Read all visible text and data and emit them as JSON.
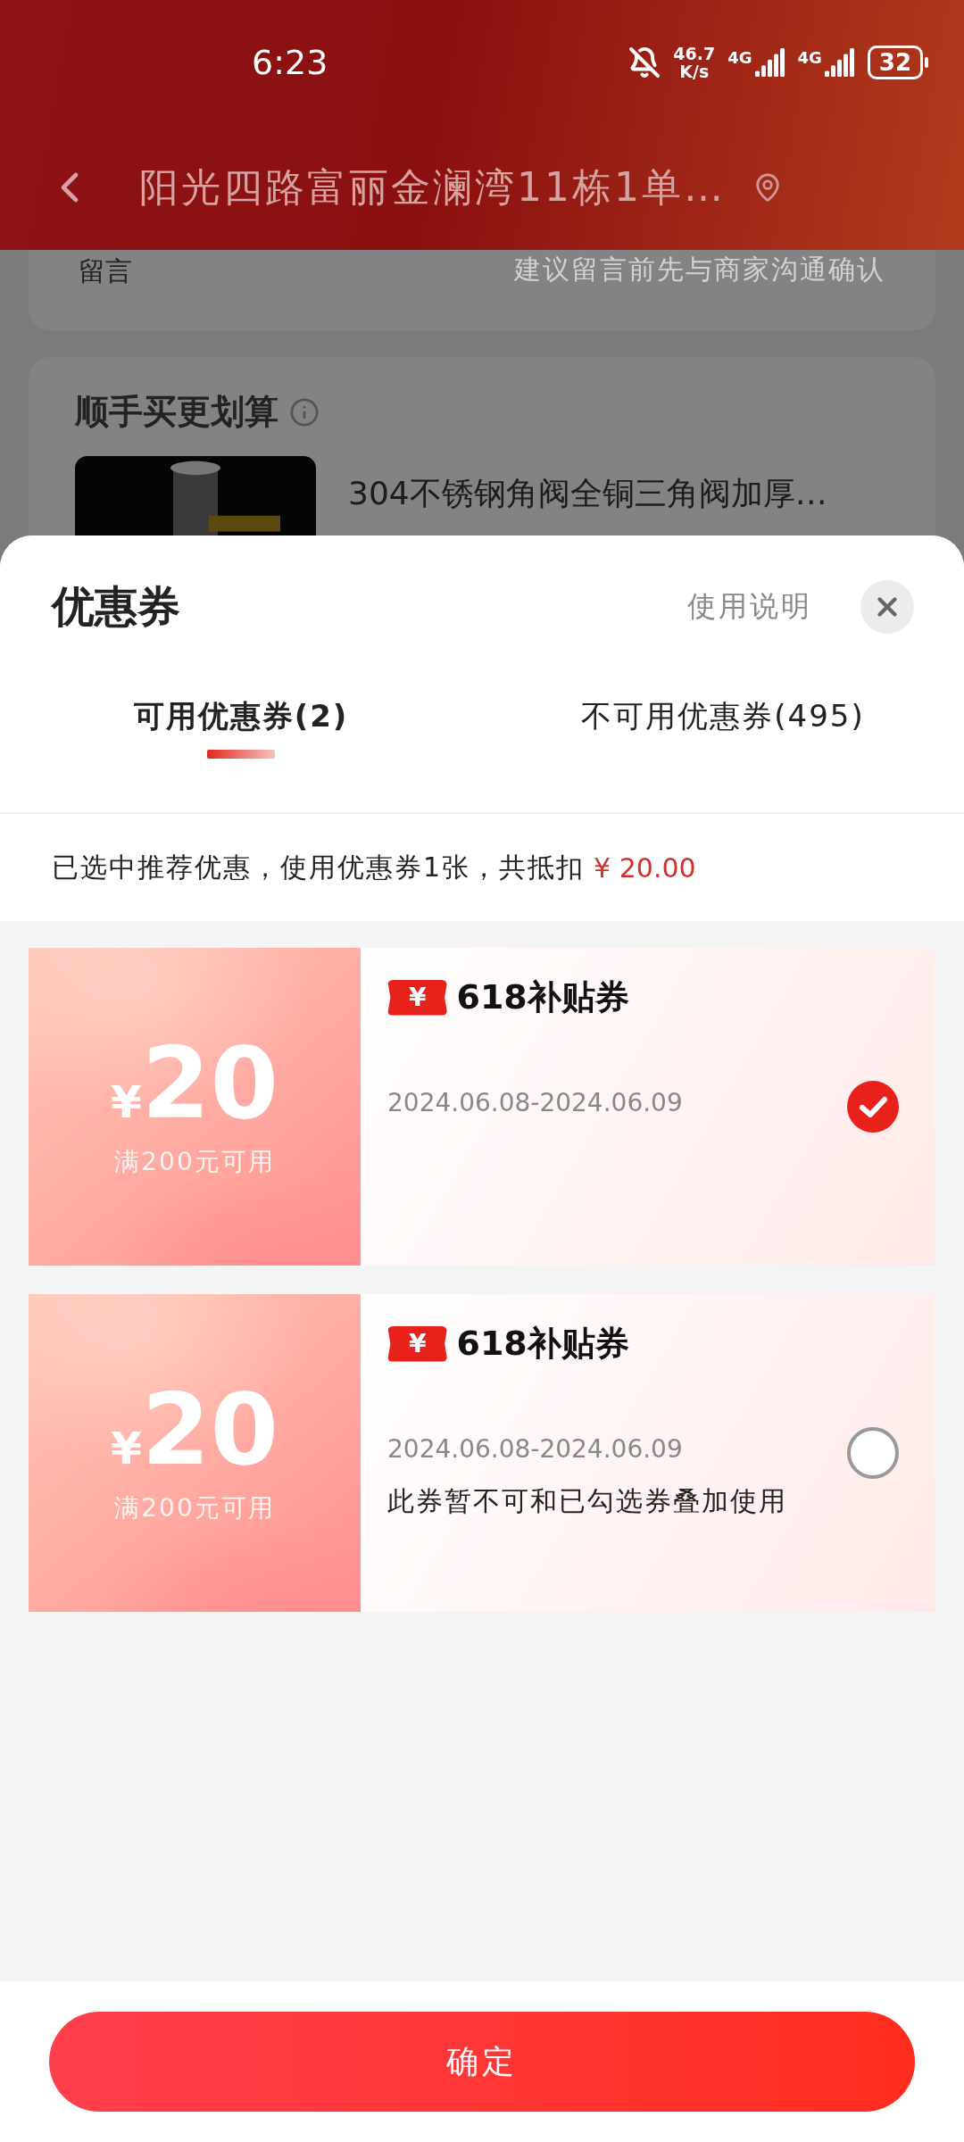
{
  "status_bar": {
    "time": "6:23",
    "net_speed": "46.7",
    "net_unit": "K/s",
    "sim_1": "4G",
    "sim_2": "4G",
    "battery": "32"
  },
  "header": {
    "title": "阳光四路富丽金澜湾11栋1单…"
  },
  "background": {
    "remark_label": "留言",
    "remark_placeholder": "建议留言前先与商家沟通确认",
    "recommend_title": "顺手买更划算",
    "product": {
      "kind": "picture",
      "name": "304不锈钢角阀全铜三角阀加厚…"
    }
  },
  "sheet": {
    "title": "优惠券",
    "help_link": "使用说明",
    "tabs": [
      {
        "label": "可用优惠券(2)",
        "selected": true
      },
      {
        "label": "不可用优惠券(495)",
        "selected": false
      }
    ],
    "summary": "已选中推荐优惠，使用优惠券1张，共抵扣",
    "summary_amount": "¥ 20.00",
    "coupons": [
      {
        "currency": "¥",
        "amount": "20",
        "condition": "满200元可用",
        "badge": "¥",
        "name": "618补贴券",
        "validity": "2024.06.08-2024.06.09",
        "selected": true
      },
      {
        "currency": "¥",
        "amount": "20",
        "condition": "满200元可用",
        "badge": "¥",
        "name": "618补贴券",
        "validity": "2024.06.08-2024.06.09",
        "note": "此券暂不可和已勾选券叠加使用",
        "selected": false
      }
    ],
    "confirm": "确定"
  }
}
